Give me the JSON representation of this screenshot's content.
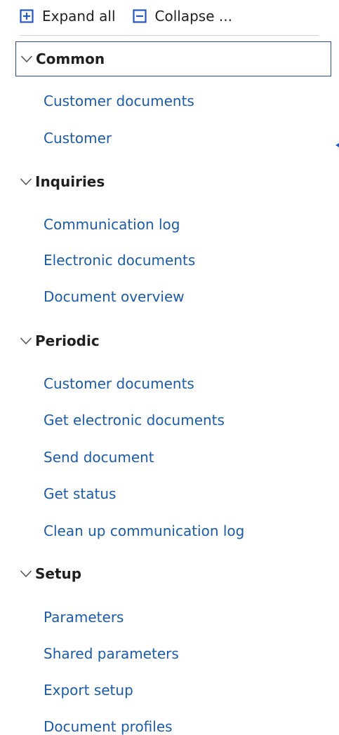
{
  "toolbar": {
    "expand_label": "Expand all",
    "collapse_label": "Collapse ..."
  },
  "sections": [
    {
      "title": "Common",
      "expanded": true,
      "items": [
        "Customer documents",
        "Customer"
      ]
    },
    {
      "title": "Inquiries",
      "expanded": true,
      "items": [
        "Communication log",
        "Electronic documents",
        "Document overview"
      ]
    },
    {
      "title": "Periodic",
      "expanded": true,
      "items": [
        "Customer documents",
        "Get electronic documents",
        "Send document",
        "Get status",
        "Clean up communication log"
      ]
    },
    {
      "title": "Setup",
      "expanded": true,
      "items": [
        "Parameters",
        "Shared parameters",
        "Export setup",
        "Document profiles"
      ]
    }
  ],
  "colors": {
    "link": "#1b5ba8",
    "icon_accent": "#2456c4",
    "focus_border": "#2a4d8f"
  }
}
